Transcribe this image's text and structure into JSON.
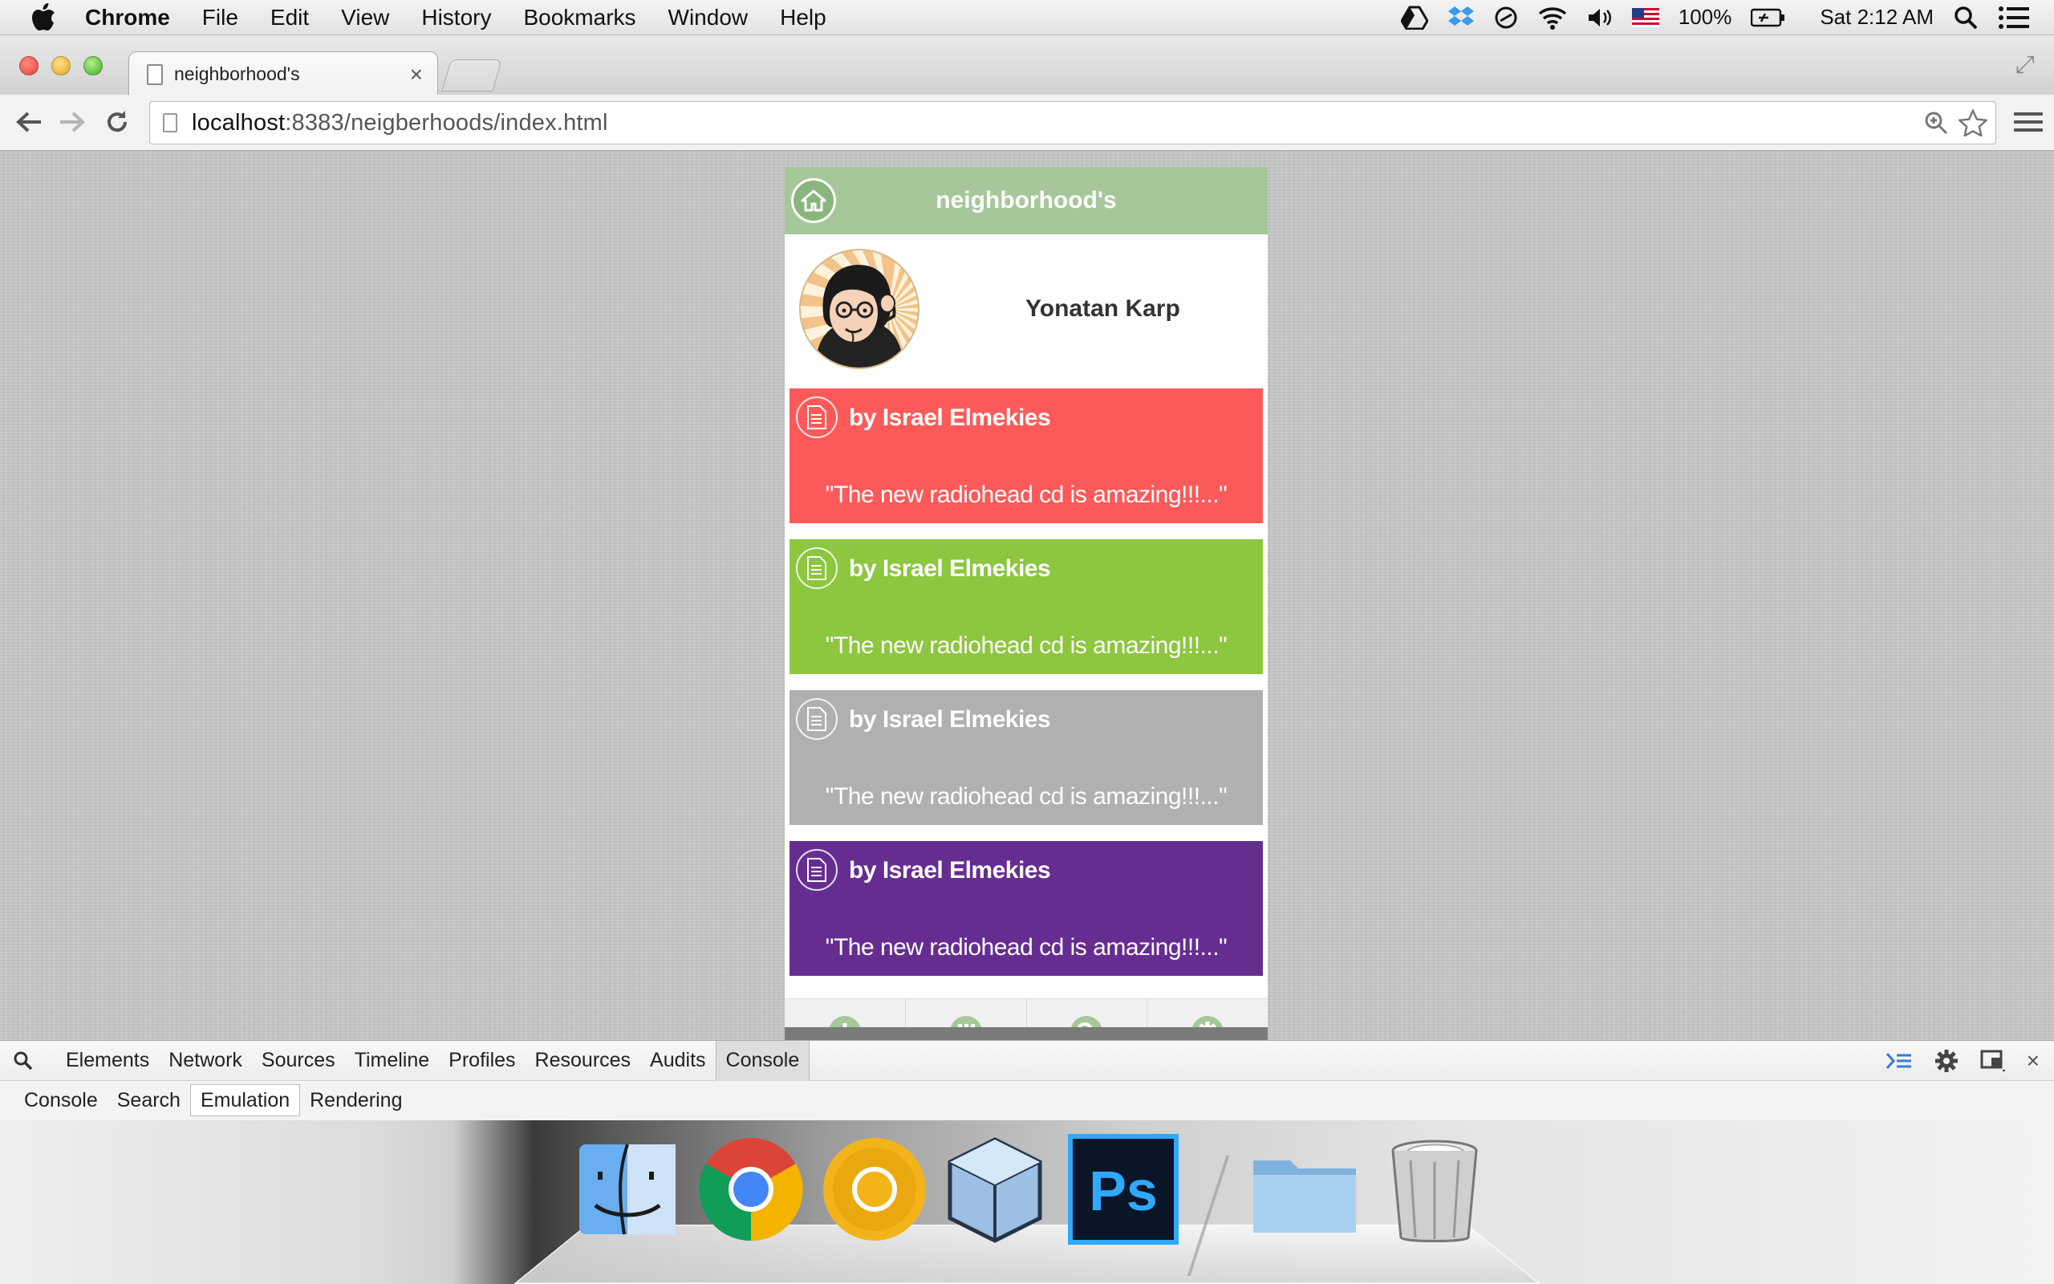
{
  "menubar": {
    "app": "Chrome",
    "items": [
      "File",
      "Edit",
      "View",
      "History",
      "Bookmarks",
      "Window",
      "Help"
    ],
    "battery": "100%",
    "clock": "Sat 2:12 AM"
  },
  "browser": {
    "tab_title": "neighborhood's",
    "url_host": "localhost",
    "url_path": ":8383/neigberhoods/index.html"
  },
  "app": {
    "title": "neighborhood's",
    "profile_name": "Yonatan Karp",
    "cards": [
      {
        "author": "by Israel Elmekies",
        "quote": "\"The new radiohead cd is amazing!!!...\"",
        "color": "#fc5a5a"
      },
      {
        "author": "by Israel Elmekies",
        "quote": "\"The new radiohead cd is amazing!!!...\"",
        "color": "#8dc63f"
      },
      {
        "author": "by Israel Elmekies",
        "quote": "\"The new radiohead cd is amazing!!!...\"",
        "color": "#b0b0b0"
      },
      {
        "author": "by Israel Elmekies",
        "quote": "\"The new radiohead cd is amazing!!!...\"",
        "color": "#662d91"
      }
    ],
    "accent": "#a6c79a"
  },
  "devtools": {
    "tabs": [
      "Elements",
      "Network",
      "Sources",
      "Timeline",
      "Profiles",
      "Resources",
      "Audits",
      "Console"
    ],
    "active_tab": "Console",
    "subtabs": [
      "Console",
      "Search",
      "Emulation",
      "Rendering"
    ],
    "active_subtab": "Emulation"
  }
}
